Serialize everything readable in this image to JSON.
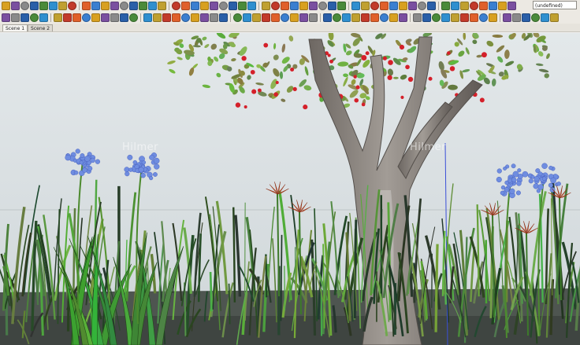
{
  "toolbar": {
    "layer_value": "(undefined)",
    "icon_colors": [
      "#2a5fa8",
      "#d8a020",
      "#c23a2a",
      "#4a8a3a",
      "#7a4fa0",
      "#e0602a",
      "#2f8fcf",
      "#8a8a8a",
      "#3a7fd0",
      "#c0a030"
    ]
  },
  "scenes": {
    "tabs": [
      {
        "label": "Scene 1"
      },
      {
        "label": "Scene 2"
      }
    ]
  },
  "viewport": {
    "watermarks": [
      "Hilmer",
      "Hilmer"
    ],
    "colors": {
      "sky": "#d9e0e2",
      "ground": "#4e5550",
      "agapanthus": "#6f8de0",
      "bird_of_paradise": "#d2512a",
      "berries": "#d4202a",
      "trunk": "#8a8480"
    }
  }
}
